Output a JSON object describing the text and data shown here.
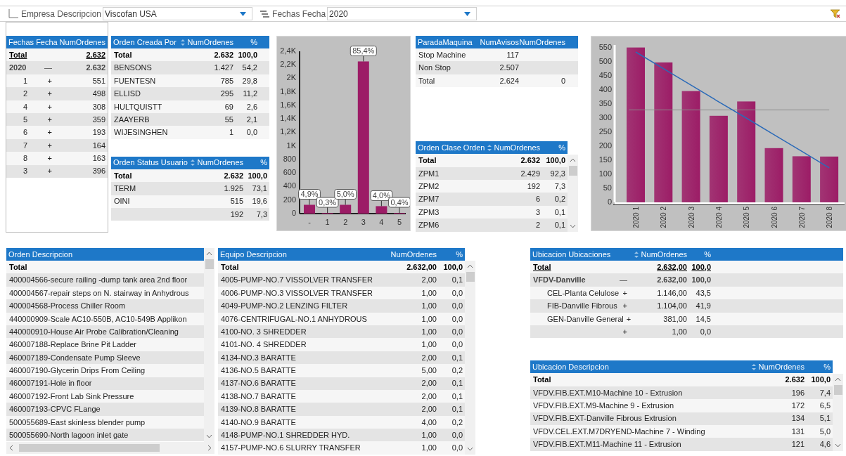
{
  "filters": [
    {
      "label": "Empresa Descripcion",
      "value": "Viscofan USA"
    },
    {
      "label": "Fechas Fecha",
      "value": "2020"
    }
  ],
  "fechas_table": {
    "columns": [
      {
        "label": "Fechas Fecha"
      },
      {
        "label": "NumOrdenes"
      }
    ],
    "rows": [
      {
        "kind": "total",
        "label": "Total",
        "underlined": true,
        "values": [
          "2.632"
        ]
      },
      {
        "kind": "group",
        "label": "2020",
        "toggle": "—",
        "underlined": false,
        "values": [
          "2.632"
        ],
        "children": [
          {
            "kind": "item",
            "label": "1",
            "toggle": "+",
            "values": [
              "551"
            ]
          },
          {
            "kind": "item",
            "label": "2",
            "toggle": "+",
            "values": [
              "498"
            ]
          },
          {
            "kind": "item",
            "label": "4",
            "toggle": "+",
            "values": [
              "308"
            ]
          },
          {
            "kind": "item",
            "label": "5",
            "toggle": "+",
            "values": [
              "359"
            ]
          },
          {
            "kind": "item",
            "label": "6",
            "toggle": "+",
            "values": [
              "193"
            ]
          },
          {
            "kind": "item",
            "label": "7",
            "toggle": "+",
            "values": [
              "164"
            ]
          },
          {
            "kind": "item",
            "label": "8",
            "toggle": "+",
            "values": [
              "163"
            ]
          },
          {
            "kind": "item",
            "label": "3",
            "toggle": "+",
            "values": [
              "396"
            ]
          }
        ]
      }
    ]
  },
  "creada_table": {
    "columns": [
      {
        "label": "Orden Creada Por",
        "sorted": false
      },
      {
        "label": "NumOrdenes",
        "sorted": true
      },
      {
        "label": "%",
        "sorted": false
      }
    ],
    "rows": [
      {
        "kind": "total",
        "label": "Total",
        "underlined": false,
        "values": [
          "2.632",
          "100,0"
        ]
      },
      {
        "kind": "item",
        "label": "BENSONS",
        "values": [
          "1.427",
          "54,2"
        ]
      },
      {
        "kind": "item",
        "label": "FUENTESN",
        "values": [
          "785",
          "29,8"
        ]
      },
      {
        "kind": "item",
        "label": "ELLISD",
        "values": [
          "295",
          "11,2"
        ]
      },
      {
        "kind": "item",
        "label": "HULTQUISTT",
        "values": [
          "69",
          "2,6"
        ]
      },
      {
        "kind": "item",
        "label": "ZAAYERB",
        "values": [
          "55",
          "2,1"
        ]
      },
      {
        "kind": "item",
        "label": "WIJESINGHEN",
        "values": [
          "1",
          "0,0"
        ]
      }
    ]
  },
  "status_table": {
    "columns": [
      {
        "label": "Orden Status Usuario",
        "sorted": false
      },
      {
        "label": "NumOrdenes",
        "sorted": true
      },
      {
        "label": "%",
        "sorted": false
      }
    ],
    "rows": [
      {
        "kind": "total",
        "label": "Total",
        "underlined": false,
        "values": [
          "2.632",
          "100,0"
        ]
      },
      {
        "kind": "item",
        "label": "TERM",
        "values": [
          "1.925",
          "73,1"
        ]
      },
      {
        "kind": "item",
        "label": "OINI",
        "values": [
          "515",
          "19,6"
        ]
      },
      {
        "kind": "item",
        "values": [
          "192",
          "7,3"
        ]
      }
    ]
  },
  "tipo_chart": {
    "chart_data": {
      "type": "bar",
      "categories": [
        "-",
        "1",
        "2",
        "3",
        "4",
        "5"
      ],
      "series": [
        {
          "color": "#9c1c66",
          "values": [
            130,
            10,
            130,
            2250,
            110,
            10
          ]
        }
      ],
      "ylim": [
        0,
        2400
      ],
      "yticks": [
        {
          "value": 0,
          "label": "0"
        },
        {
          "value": 200,
          "label": "200"
        },
        {
          "value": 400,
          "label": "400"
        },
        {
          "value": 600,
          "label": "600"
        },
        {
          "value": 800,
          "label": "800"
        },
        {
          "value": 1000,
          "label": "1K"
        },
        {
          "value": 1200,
          "label": "1,2K"
        },
        {
          "value": 1400,
          "label": "1,4K"
        },
        {
          "value": 1600,
          "label": "1,6K"
        },
        {
          "value": 1800,
          "label": "1,8K"
        },
        {
          "value": 2000,
          "label": "2K"
        },
        {
          "value": 2200,
          "label": "2,2K"
        },
        {
          "value": 2400,
          "label": "2,4K"
        }
      ],
      "value_labels": [
        "4,9%",
        "0,3%",
        "5,0%",
        "85,4%",
        "4,0%",
        "0,4%"
      ]
    }
  },
  "parada_table": {
    "columns": [
      {
        "label": "ParadaMaquina"
      },
      {
        "label": "NumAvisos"
      },
      {
        "label": "NumOrdenes"
      }
    ],
    "rows": [
      {
        "kind": "item",
        "label": "Stop Machine",
        "values": [
          "117"
        ]
      },
      {
        "kind": "item",
        "label": "Non Stop",
        "values": [
          "2.507"
        ]
      },
      {
        "kind": "item",
        "label": "Total",
        "values": [
          "2.624",
          "0"
        ]
      }
    ]
  },
  "clase_table": {
    "columns": [
      {
        "label": "Orden Clase Orden",
        "sorted": false
      },
      {
        "label": "NumOrdenes",
        "sorted": true
      },
      {
        "label": "%",
        "sorted": false
      }
    ],
    "rows": [
      {
        "kind": "total",
        "label": "Total",
        "underlined": false,
        "values": [
          "2.632",
          "100,0"
        ]
      },
      {
        "kind": "item",
        "label": "ZPM1",
        "values": [
          "2.429",
          "92,3"
        ]
      },
      {
        "kind": "item",
        "label": "ZPM2",
        "values": [
          "192",
          "7,3"
        ]
      },
      {
        "kind": "item",
        "label": "ZPM7",
        "values": [
          "6",
          "0,2"
        ]
      },
      {
        "kind": "item",
        "label": "ZPM3",
        "values": [
          "3",
          "0,1"
        ]
      },
      {
        "kind": "item",
        "label": "ZPM6",
        "values": [
          "2",
          "0,1"
        ]
      }
    ]
  },
  "mes_chart": {
    "chart_data": {
      "type": "bar",
      "categories": [
        "2020 1",
        "2020 2",
        "2020 3",
        "2020 4",
        "2020 5",
        "2020 6",
        "2020 7",
        "2020 8"
      ],
      "series": [
        {
          "color": "#9c1c66",
          "values": [
            551,
            498,
            396,
            308,
            359,
            193,
            164,
            163
          ]
        },
        {
          "type": "line",
          "color": "#2a6ab8",
          "values": [
            535,
            476,
            417,
            358,
            300,
            241,
            182,
            123
          ]
        }
      ],
      "ylim": [
        0,
        560
      ],
      "yticks": [
        0,
        50,
        100,
        150,
        200,
        250,
        300,
        350,
        400,
        450,
        500,
        550
      ],
      "ref_lines": [
        {
          "axis": "y",
          "value": 329,
          "color": "#8a8a8a"
        }
      ]
    }
  },
  "descripcion_table": {
    "columns": [
      {
        "label": "Orden Descripcion"
      }
    ],
    "rows": [
      {
        "kind": "total",
        "label": "Total",
        "underlined": false,
        "values": []
      },
      {
        "kind": "item",
        "label": "400004566-secure railing -dump tank area 2nd floor",
        "values": []
      },
      {
        "kind": "item",
        "label": "400004567-repair steps on N. stairway in Anhydrous",
        "values": []
      },
      {
        "kind": "item",
        "label": "400004568-Process Chiller Room",
        "values": []
      },
      {
        "kind": "item",
        "label": "440000909-Scale AC10-550B, AC10-549B Applikon",
        "values": []
      },
      {
        "kind": "item",
        "label": "440000910-House Air Probe Calibration/Cleaning",
        "values": []
      },
      {
        "kind": "item",
        "label": "460007188-Replace Brine Pit Ladder",
        "values": []
      },
      {
        "kind": "item",
        "label": "460007189-Condensate Pump Sleeve",
        "values": []
      },
      {
        "kind": "item",
        "label": "460007190-Glycerin Drips From Ceiling",
        "values": []
      },
      {
        "kind": "item",
        "label": "460007191-Hole in floor",
        "values": []
      },
      {
        "kind": "item",
        "label": "460007192-Front Lab Sink Pressure",
        "values": []
      },
      {
        "kind": "item",
        "label": "460007193-CPVC FLange",
        "values": []
      },
      {
        "kind": "item",
        "label": "500055689-East skinless blender pump",
        "values": []
      },
      {
        "kind": "item",
        "label": "500055690-North lagoon inlet gate",
        "values": []
      }
    ]
  },
  "equipo_table": {
    "columns": [
      {
        "label": "Equipo Descripcion"
      },
      {
        "label": "NumOrdenes"
      },
      {
        "label": "%"
      }
    ],
    "rows": [
      {
        "kind": "total",
        "label": "Total",
        "underlined": false,
        "values": [
          "2.632,00",
          "100,0"
        ]
      },
      {
        "kind": "item",
        "label": "4005-PUMP-NO.7 VISSOLVER TRANSFER",
        "values": [
          "2,00",
          "0,1"
        ]
      },
      {
        "kind": "item",
        "label": "4006-PUMP-NO.3 VISSOLVER TRANSFER",
        "values": [
          "1,00",
          "0,0"
        ]
      },
      {
        "kind": "item",
        "label": "4049-PUMP-NO.2 LENZING FILTER",
        "values": [
          "1,00",
          "0,0"
        ]
      },
      {
        "kind": "item",
        "label": "4076-CENTRIFUGAL-NO.1 ANHYDROUS",
        "values": [
          "1,00",
          "0,0"
        ]
      },
      {
        "kind": "item",
        "label": "4100-NO. 3 SHREDDER",
        "values": [
          "1,00",
          "0,0"
        ]
      },
      {
        "kind": "item",
        "label": "4101-NO. 4 SHREDDER",
        "values": [
          "1,00",
          "0,0"
        ]
      },
      {
        "kind": "item",
        "label": "4134-NO.3 BARATTE",
        "values": [
          "2,00",
          "0,1"
        ]
      },
      {
        "kind": "item",
        "label": "4136-NO.5 BARATTE",
        "values": [
          "5,00",
          "0,2"
        ]
      },
      {
        "kind": "item",
        "label": "4137-NO.6 BARATTE",
        "values": [
          "2,00",
          "0,1"
        ]
      },
      {
        "kind": "item",
        "label": "4138-NO.7 BARATTE",
        "values": [
          "2,00",
          "0,1"
        ]
      },
      {
        "kind": "item",
        "label": "4139-NO.8 BARATTE",
        "values": [
          "2,00",
          "0,1"
        ]
      },
      {
        "kind": "item",
        "label": "4140-NO.9 BARATTE",
        "values": [
          "4,00",
          "0,2"
        ]
      },
      {
        "kind": "item",
        "label": "4148-PUMP-NO.1 SHREDDER HYD.",
        "values": [
          "1,00",
          "0,0"
        ]
      },
      {
        "kind": "item",
        "label": "4157-PUMP-NO.6 SLURRY TRANSFER",
        "values": [
          "1,00",
          "0,0"
        ]
      }
    ]
  },
  "ubicaciones_table": {
    "columns": [
      {
        "label": "Ubicacion Ubicaciones",
        "sorted": false
      },
      {
        "label": "NumOrdenes",
        "sorted": true
      },
      {
        "label": "%",
        "sorted": false
      }
    ],
    "rows": [
      {
        "kind": "total",
        "label": "Total",
        "underlined": true,
        "values": [
          "2.632,00",
          "100,0"
        ]
      },
      {
        "kind": "group",
        "label": "VFDV-Danville",
        "toggle": "—",
        "underlined": false,
        "values": [
          "2.632,00",
          "100,0"
        ],
        "children": [
          {
            "kind": "item",
            "label": "CEL-Planta Celulose",
            "toggle": "+",
            "values": [
              "1.146,00",
              "43,5"
            ]
          },
          {
            "kind": "item",
            "label": "FIB-Danville Fibrous",
            "toggle": "+",
            "values": [
              "1.104,00",
              "41,9"
            ]
          },
          {
            "kind": "item",
            "label": "GEN-Danville General",
            "toggle": "+",
            "values": [
              "381,00",
              "14,5"
            ]
          },
          {
            "kind": "item",
            "toggle": "+",
            "values": [
              "1,00",
              "0,0"
            ]
          }
        ]
      }
    ]
  },
  "ubicacion_desc_table": {
    "columns": [
      {
        "label": "Ubicacion Descripcion",
        "sorted": false
      },
      {
        "label": "NumOrdenes",
        "sorted": true
      },
      {
        "label": "%",
        "sorted": false
      }
    ],
    "rows": [
      {
        "kind": "total",
        "label": "Total",
        "underlined": false,
        "values": [
          "2.632",
          "100,0"
        ]
      },
      {
        "kind": "item",
        "label": "VFDV.FIB.EXT.M10-Machine 10 - Extrusion",
        "values": [
          "196",
          "7,4"
        ]
      },
      {
        "kind": "item",
        "label": "VFDV.FIB.EXT.M9-Machine 9 - Extrusion",
        "values": [
          "172",
          "6,5"
        ]
      },
      {
        "kind": "item",
        "label": "VFDV.FIB.EXT-Danville Fibrous Extrusion",
        "values": [
          "134",
          "5,1"
        ]
      },
      {
        "kind": "item",
        "label": "VFDV.CEL.EXT.M7DRYEND-Machine 7 - Winding",
        "values": [
          "131",
          "5,0"
        ]
      },
      {
        "kind": "item",
        "label": "VFDV.FIB.EXT.M11-Machine 11 - Extrusion",
        "values": [
          "121",
          "4,6"
        ]
      }
    ]
  }
}
